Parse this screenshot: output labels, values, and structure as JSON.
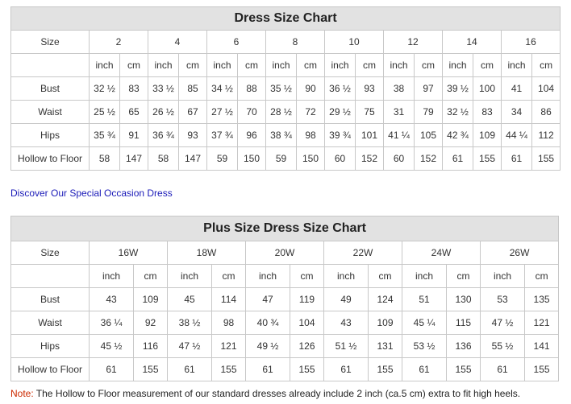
{
  "chart1": {
    "title": "Dress Size Chart",
    "size_label": "Size",
    "sizes": [
      "2",
      "4",
      "6",
      "8",
      "10",
      "12",
      "14",
      "16"
    ],
    "units": [
      "inch",
      "cm"
    ],
    "rows": [
      {
        "label": "Bust",
        "values": [
          "32 ½",
          "83",
          "33 ½",
          "85",
          "34 ½",
          "88",
          "35 ½",
          "90",
          "36 ½",
          "93",
          "38",
          "97",
          "39 ½",
          "100",
          "41",
          "104"
        ]
      },
      {
        "label": "Waist",
        "values": [
          "25 ½",
          "65",
          "26 ½",
          "67",
          "27 ½",
          "70",
          "28 ½",
          "72",
          "29 ½",
          "75",
          "31",
          "79",
          "32 ½",
          "83",
          "34",
          "86"
        ]
      },
      {
        "label": "Hips",
        "values": [
          "35 ¾",
          "91",
          "36 ¾",
          "93",
          "37 ¾",
          "96",
          "38 ¾",
          "98",
          "39 ¾",
          "101",
          "41 ¼",
          "105",
          "42 ¾",
          "109",
          "44 ¼",
          "112"
        ]
      },
      {
        "label": "Hollow to Floor",
        "values": [
          "58",
          "147",
          "58",
          "147",
          "59",
          "150",
          "59",
          "150",
          "60",
          "152",
          "60",
          "152",
          "61",
          "155",
          "61",
          "155"
        ]
      }
    ]
  },
  "discover_link": "Discover Our Special Occasion Dress",
  "chart2": {
    "title": "Plus Size Dress Size Chart",
    "size_label": "Size",
    "sizes": [
      "16W",
      "18W",
      "20W",
      "22W",
      "24W",
      "26W"
    ],
    "units": [
      "inch",
      "cm"
    ],
    "rows": [
      {
        "label": "Bust",
        "values": [
          "43",
          "109",
          "45",
          "114",
          "47",
          "119",
          "49",
          "124",
          "51",
          "130",
          "53",
          "135"
        ]
      },
      {
        "label": "Waist",
        "values": [
          "36 ¼",
          "92",
          "38 ½",
          "98",
          "40 ¾",
          "104",
          "43",
          "109",
          "45 ¼",
          "115",
          "47 ½",
          "121"
        ]
      },
      {
        "label": "Hips",
        "values": [
          "45 ½",
          "116",
          "47 ½",
          "121",
          "49 ½",
          "126",
          "51 ½",
          "131",
          "53 ½",
          "136",
          "55 ½",
          "141"
        ]
      },
      {
        "label": "Hollow to Floor",
        "values": [
          "61",
          "155",
          "61",
          "155",
          "61",
          "155",
          "61",
          "155",
          "61",
          "155",
          "61",
          "155"
        ]
      }
    ]
  },
  "note": {
    "label": "Note:",
    "text": " The Hollow to Floor measurement of our standard dresses already include 2 inch (ca.5 cm) extra to fit high heels."
  },
  "colors": {
    "title_bg": "#e2e2e2",
    "border": "#c8c8c8",
    "link": "#1a1ab8",
    "note_label": "#cc2a00"
  }
}
